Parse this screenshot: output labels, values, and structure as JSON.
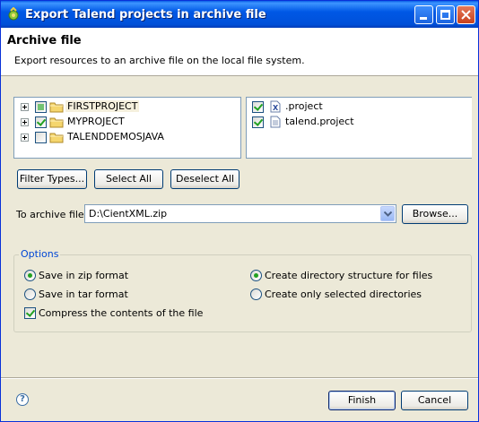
{
  "window": {
    "title": "Export Talend projects in archive file"
  },
  "banner": {
    "title": "Archive file",
    "description": "Export resources to an archive file on the local file system."
  },
  "projects": [
    {
      "label": "FIRSTPROJECT",
      "state": "partial"
    },
    {
      "label": "MYPROJECT",
      "state": "checked"
    },
    {
      "label": "TALENDDEMOSJAVA",
      "state": "unchecked"
    }
  ],
  "files": [
    {
      "label": ".project",
      "checked": true
    },
    {
      "label": "talend.project",
      "checked": true
    }
  ],
  "buttons": {
    "filter_types": "Filter Types...",
    "select_all": "Select All",
    "deselect_all": "Deselect All",
    "browse": "Browse...",
    "finish": "Finish",
    "cancel": "Cancel"
  },
  "archive": {
    "label": "To archive file:",
    "value": "D:\\CientXML.zip"
  },
  "options": {
    "legend": "Options",
    "save_zip": "Save in zip format",
    "save_tar": "Save in tar format",
    "compress": "Compress the contents of the file",
    "create_structure": "Create directory structure for files",
    "create_selected": "Create only selected directories",
    "format_selected": "zip",
    "structure_selected": "create_structure",
    "compress_checked": true
  },
  "help_glyph": "?",
  "colors": {
    "titlebar": "#0058e6",
    "dialog_bg": "#ece9d8",
    "checkmark": "#21a121",
    "legend": "#0046d5"
  }
}
